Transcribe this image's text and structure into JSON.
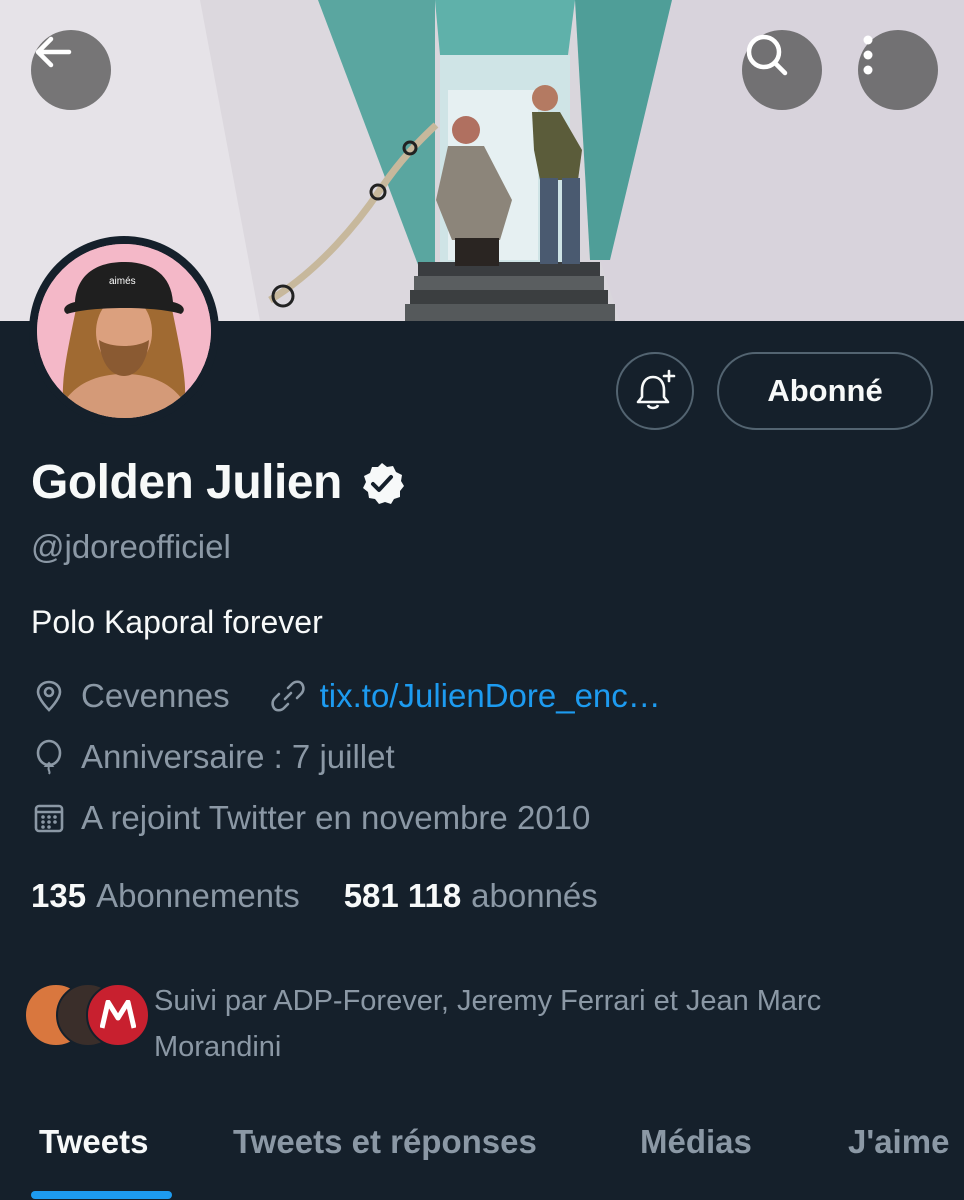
{
  "header": {
    "back_icon": "arrow-left-icon",
    "search_icon": "search-icon",
    "more_icon": "more-vertical-icon"
  },
  "profile": {
    "display_name": "Golden Julien",
    "handle": "@jdoreofficiel",
    "bio": "Polo Kaporal forever",
    "location": "Cevennes",
    "website": "tix.to/JulienDore_enc…",
    "birthday": "Anniversaire : 7 juillet",
    "joined": "A rejoint Twitter en novembre 2010",
    "verified_icon": "verified-badge-icon"
  },
  "actions": {
    "notify_icon": "bell-plus-icon",
    "follow_label": "Abonné"
  },
  "stats": {
    "following_count": "135",
    "following_label": "Abonnements",
    "followers_count": "581 118",
    "followers_label": "abonnés"
  },
  "followed_by": {
    "text": "Suivi par ADP-Forever, Jeremy Ferrari et Jean Marc Morandini"
  },
  "tabs": [
    {
      "label": "Tweets",
      "active": true
    },
    {
      "label": "Tweets et réponses",
      "active": false
    },
    {
      "label": "Médias",
      "active": false
    },
    {
      "label": "J'aime",
      "active": false
    }
  ],
  "colors": {
    "background": "#15202b",
    "accent": "#1d9bf0",
    "secondary_text": "#8b98a5",
    "primary_text": "#f7f9f9"
  }
}
